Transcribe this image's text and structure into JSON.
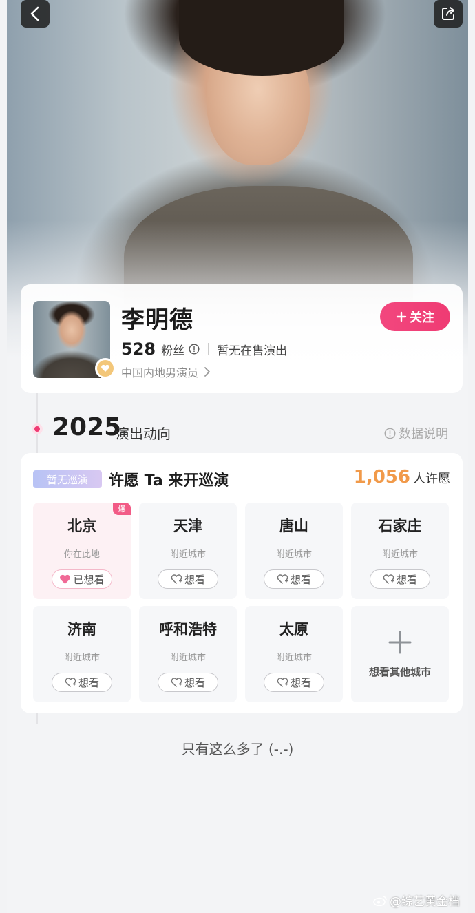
{
  "profile": {
    "name": "李明德",
    "fans_count": "528",
    "fans_label": "粉丝",
    "no_show": "暂无在售演出",
    "occupation": "中国内地男演员",
    "follow_label": "关注"
  },
  "timeline": {
    "year": "2025",
    "section_title": "演出动向",
    "data_note": "数据说明"
  },
  "tour": {
    "badge": "暂无巡演",
    "title": "许愿 Ta 来开巡演",
    "wish_count": "1,056",
    "wish_label": "人许愿",
    "cities": [
      {
        "name": "北京",
        "sub": "你在此地",
        "button": "已想看",
        "tag": "爆"
      },
      {
        "name": "天津",
        "sub": "附近城市",
        "button": "想看"
      },
      {
        "name": "唐山",
        "sub": "附近城市",
        "button": "想看"
      },
      {
        "name": "石家庄",
        "sub": "附近城市",
        "button": "想看"
      },
      {
        "name": "济南",
        "sub": "附近城市",
        "button": "想看"
      },
      {
        "name": "呼和浩特",
        "sub": "附近城市",
        "button": "想看"
      },
      {
        "name": "太原",
        "sub": "附近城市",
        "button": "想看"
      }
    ],
    "add_city_label": "想看其他城市"
  },
  "footer": {
    "end_text": "只有这么多了 (-.-)",
    "watermark": "@综艺黄金档"
  },
  "colors": {
    "accent_pink": "#ef3b73",
    "wish_orange": "#f19a4a"
  },
  "icons": [
    "back-arrow-icon",
    "share-icon",
    "info-icon",
    "chevron-right-icon",
    "heart-icon",
    "heart-plus-icon",
    "plus-icon"
  ]
}
